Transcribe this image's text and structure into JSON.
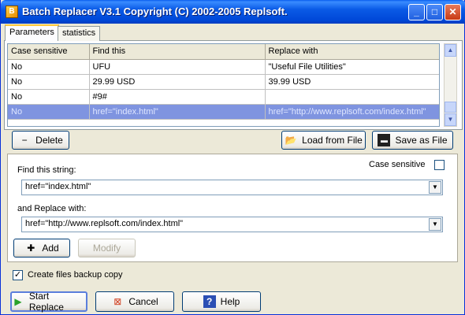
{
  "window": {
    "title": "Batch Replacer V3.1 Copyright (C) 2002-2005 Replsoft."
  },
  "tabs": [
    {
      "label": "Parameters"
    },
    {
      "label": "statistics"
    }
  ],
  "grid": {
    "columns": [
      "Case sensitive",
      "Find this",
      "Replace with"
    ],
    "rows": [
      [
        "No",
        "UFU",
        "\"Useful File Utilities\""
      ],
      [
        "No",
        "29.99 USD",
        "39.99 USD"
      ],
      [
        "No",
        "#9#",
        ""
      ],
      [
        "No",
        "href=\"index.html\"",
        "href=\"http://www.replsoft.com/index.html\""
      ]
    ]
  },
  "toolbar": {
    "delete_label": "Delete",
    "load_label": "Load from File",
    "save_label": "Save as File"
  },
  "form": {
    "find_label": "Find this string:",
    "find_value": "href=\"index.html\"",
    "case_label": "Case sensitive",
    "replace_label": "and Replace with:",
    "replace_value": "href=\"http://www.replsoft.com/index.html\"",
    "add_label": "Add",
    "modify_label": "Modify"
  },
  "backup": {
    "label": "Create files backup copy",
    "checked": true
  },
  "actions": {
    "start_label": "Start Replace",
    "cancel_label": "Cancel",
    "help_label": "Help"
  }
}
